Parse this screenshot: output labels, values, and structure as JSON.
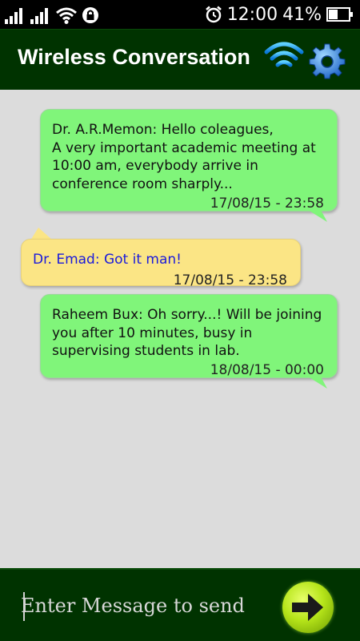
{
  "status_bar": {
    "time": "12:00",
    "battery_percent": "41%",
    "icons": [
      "signal-icon",
      "signal-icon",
      "wifi-icon",
      "lock-icon",
      "alarm-icon",
      "battery-icon"
    ]
  },
  "header": {
    "title": "Wireless Conversation",
    "wifi_button_icon": "wifi-icon",
    "settings_button_icon": "gear-icon"
  },
  "messages": [
    {
      "direction": "out",
      "text": "Dr. A.R.Memon: Hello coleagues,\nA very important academic meeting at 10:00 am, everybody arrive in conference room sharply...",
      "timestamp": "17/08/15 - 23:58"
    },
    {
      "direction": "in",
      "text": "Dr. Emad: Got it man!",
      "timestamp": "17/08/15 - 23:58"
    },
    {
      "direction": "out",
      "text": "Raheem Bux: Oh sorry...! Will be joining you after 10 minutes, busy in supervising students in lab.",
      "timestamp": "18/08/15 - 00:00"
    }
  ],
  "composer": {
    "placeholder": "Enter Message to send",
    "value": "",
    "send_icon": "arrow-right-icon"
  },
  "colors": {
    "header_bg": "#003300",
    "chat_bg": "#dcdcdc",
    "bubble_out": "#80f57a",
    "bubble_in": "#fbe585",
    "incoming_text": "#1a1adc"
  }
}
